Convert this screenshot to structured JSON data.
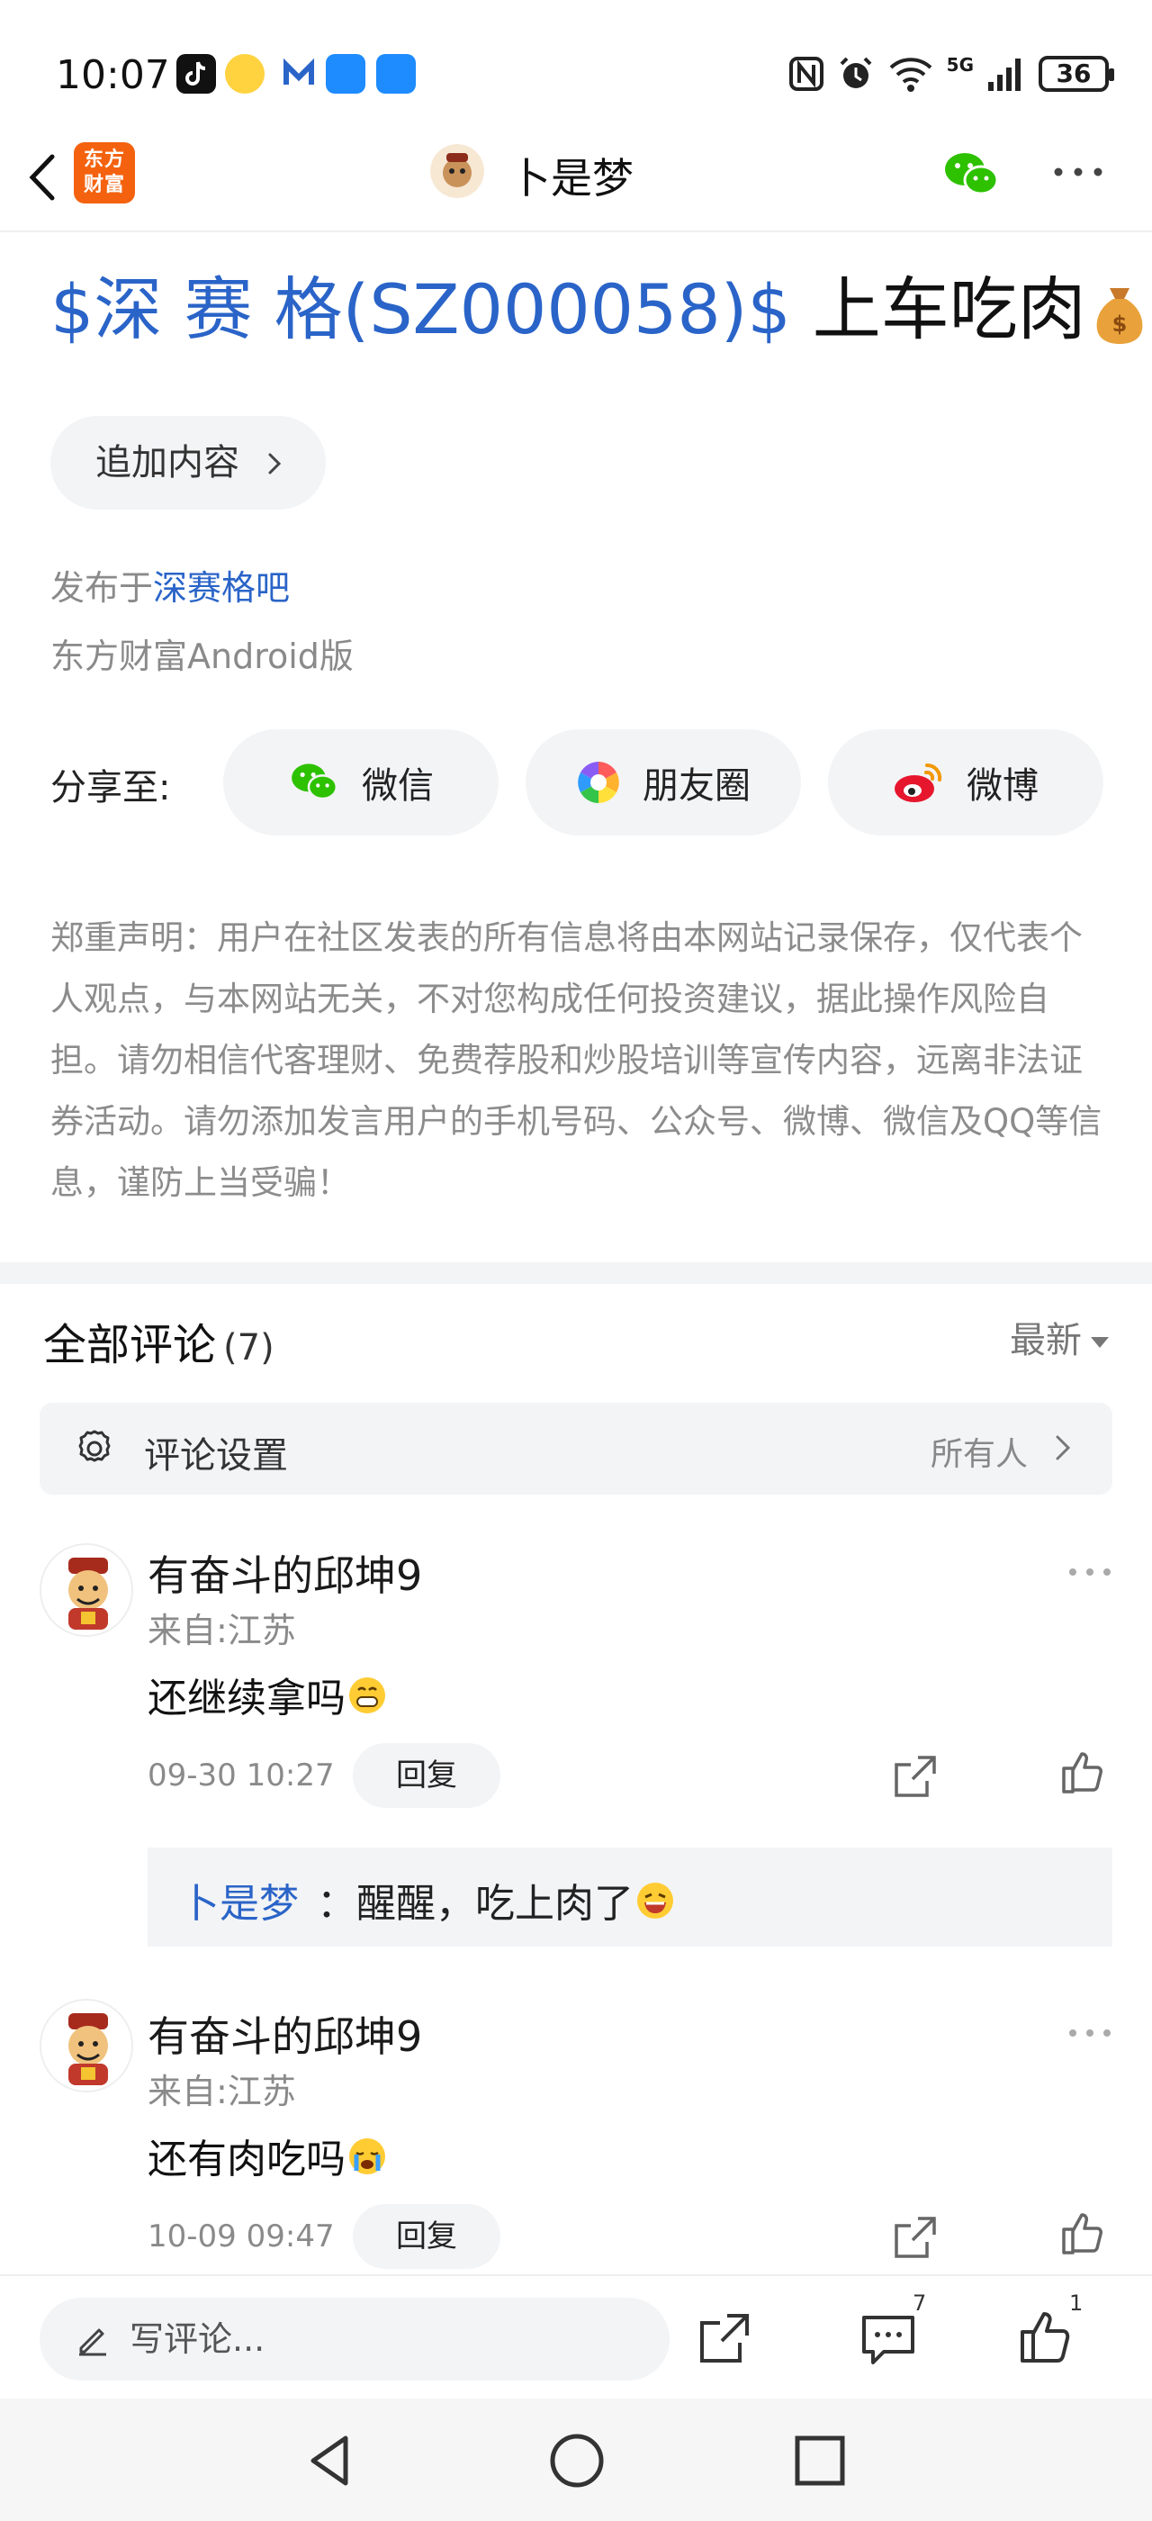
{
  "status_bar": {
    "time": "10:07",
    "network": "5G",
    "battery": "36"
  },
  "header": {
    "brand_logo": "东方\n财富",
    "brand_line1": "东方",
    "brand_line2": "财富",
    "author": "卜是梦"
  },
  "post": {
    "stock_tag": "$深 赛 格(SZ000058)$",
    "title_text": "上车吃肉",
    "append_label": "追加内容",
    "published_prefix": "发布于",
    "published_bar": "深赛格吧",
    "client": "东方财富Android版",
    "share_label": "分享至:",
    "share_options": [
      {
        "label": "微信",
        "icon": "wechat-icon"
      },
      {
        "label": "朋友圈",
        "icon": "moments-icon"
      },
      {
        "label": "微博",
        "icon": "weibo-icon"
      }
    ],
    "disclaimer": "郑重声明：用户在社区发表的所有信息将由本网站记录保存，仅代表个人观点，与本网站无关，不对您构成任何投资建议，据此操作风险自担。请勿相信代客理财、免费荐股和炒股培训等宣传内容，远离非法证券活动。请勿添加发言用户的手机号码、公众号、微博、微信及QQ等信息，谨防上当受骗！"
  },
  "comments_section": {
    "title": "全部评论",
    "count": "(7)",
    "sort_label": "最新",
    "settings_label": "评论设置",
    "settings_value": "所有人"
  },
  "comments": [
    {
      "name": "有奋斗的邱坤9",
      "location": "来自:江苏",
      "text": "还继续拿吗",
      "time": "09-30 10:27",
      "reply_label": "回复",
      "reply": {
        "author": "卜是梦",
        "text": "：醒醒，吃上肉了"
      }
    },
    {
      "name": "有奋斗的邱坤9",
      "location": "来自:江苏",
      "text": "还有肉吃吗",
      "time": "10-09 09:47",
      "reply_label": "回复"
    }
  ],
  "bottom_bar": {
    "write_placeholder": "写评论...",
    "comment_count": "7",
    "like_count": "1"
  },
  "colors": {
    "accent_blue": "#2a64c8",
    "brand_orange": "#f4620f",
    "wechat_green": "#2dc100",
    "weibo_red": "#e6162d"
  }
}
